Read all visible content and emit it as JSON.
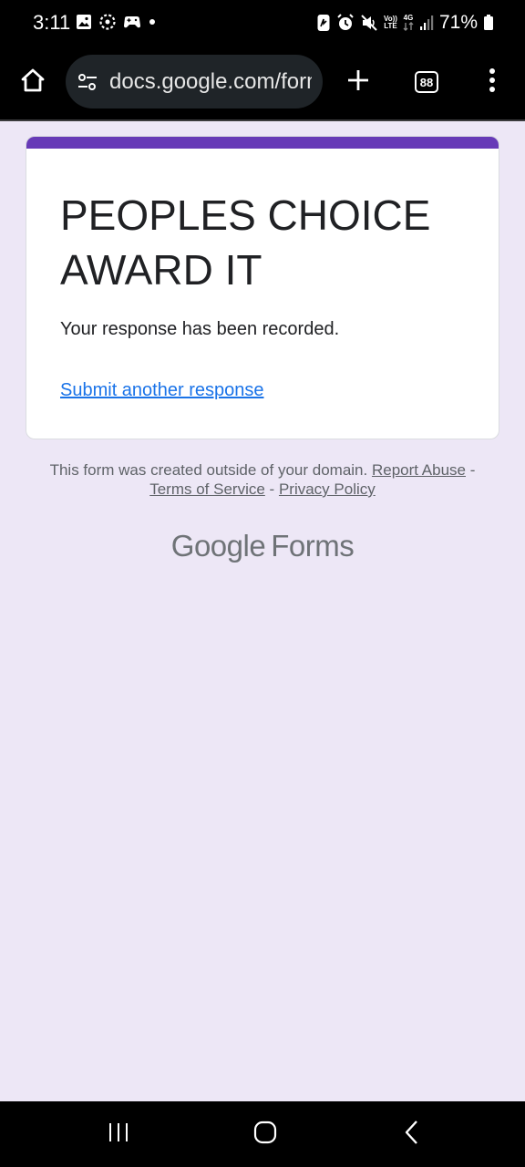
{
  "status_bar": {
    "time": "3:11",
    "network_top": "Vo))",
    "network_bottom": "LTE",
    "network_type": "4G",
    "battery": "71%"
  },
  "browser": {
    "url": "docs.google.com/forms",
    "tab_count": "88"
  },
  "form": {
    "title": "PEOPLES CHOICE AWARD IT",
    "confirmation": "Your response has been recorded.",
    "another_link": "Submit another response",
    "accent_color": "#673ab7"
  },
  "footer": {
    "note": "This form was created outside of your domain.",
    "report_abuse": "Report Abuse",
    "separator": "-",
    "terms": "Terms of Service",
    "privacy": "Privacy Policy",
    "brand_google": "Google",
    "brand_forms": "Forms"
  },
  "icons": {
    "status_left": [
      "image-icon",
      "loading-icon",
      "game-controller-icon",
      "dot-icon"
    ],
    "status_right": [
      "nfc-icon",
      "alarm-icon",
      "mute-icon",
      "network-label",
      "signal-icon",
      "battery-icon"
    ],
    "toolbar": [
      "home-icon",
      "tune-icon",
      "plus-icon",
      "tabs-icon",
      "more-vert-icon"
    ],
    "nav": [
      "recents-icon",
      "home-circle-icon",
      "back-icon"
    ]
  }
}
